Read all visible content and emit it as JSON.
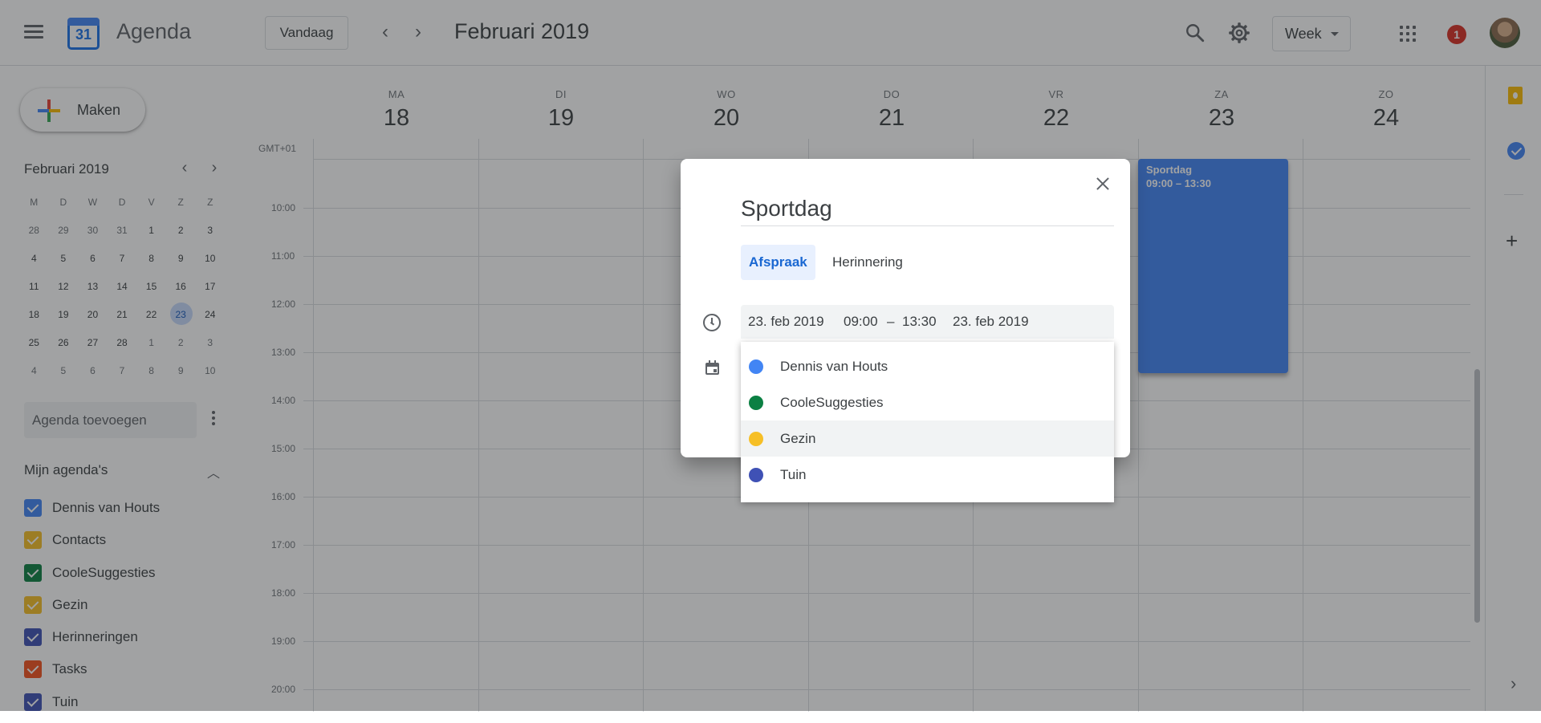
{
  "header": {
    "app_title": "Agenda",
    "logo_number": "31",
    "today_button": "Vandaag",
    "period_title": "Februari 2019",
    "view_selector": "Week",
    "notification_count": "1"
  },
  "sidebar": {
    "create_label": "Maken",
    "mini_calendar": {
      "title": "Februari 2019",
      "weekday_headers": [
        "M",
        "D",
        "W",
        "D",
        "V",
        "Z",
        "Z"
      ],
      "weeks": [
        [
          "28",
          "29",
          "30",
          "31",
          "1",
          "2",
          "3"
        ],
        [
          "4",
          "5",
          "6",
          "7",
          "8",
          "9",
          "10"
        ],
        [
          "11",
          "12",
          "13",
          "14",
          "15",
          "16",
          "17"
        ],
        [
          "18",
          "19",
          "20",
          "21",
          "22",
          "23",
          "24"
        ],
        [
          "25",
          "26",
          "27",
          "28",
          "1",
          "2",
          "3"
        ],
        [
          "4",
          "5",
          "6",
          "7",
          "8",
          "9",
          "10"
        ]
      ],
      "selected_day": "23"
    },
    "add_calendar_placeholder": "Agenda toevoegen",
    "my_calendars_title": "Mijn agenda's",
    "calendars": [
      {
        "name": "Dennis van Houts",
        "color": "#4285f4",
        "checked": true
      },
      {
        "name": "Contacts",
        "color": "#f6bf26",
        "checked": true
      },
      {
        "name": "CooleSuggesties",
        "color": "#0b8043",
        "checked": true
      },
      {
        "name": "Gezin",
        "color": "#f6bf26",
        "checked": true
      },
      {
        "name": "Herinneringen",
        "color": "#3f51b5",
        "checked": true
      },
      {
        "name": "Tasks",
        "color": "#f4511e",
        "checked": true
      },
      {
        "name": "Tuin",
        "color": "#3f51b5",
        "checked": true
      }
    ]
  },
  "week": {
    "timezone_label": "GMT+01",
    "days": [
      {
        "name": "MA",
        "number": "18"
      },
      {
        "name": "DI",
        "number": "19"
      },
      {
        "name": "WO",
        "number": "20"
      },
      {
        "name": "DO",
        "number": "21"
      },
      {
        "name": "VR",
        "number": "22"
      },
      {
        "name": "ZA",
        "number": "23"
      },
      {
        "name": "ZO",
        "number": "24"
      }
    ],
    "hours": [
      "10:00",
      "11:00",
      "12:00",
      "13:00",
      "14:00",
      "15:00",
      "16:00",
      "17:00",
      "18:00",
      "19:00",
      "20:00"
    ],
    "event": {
      "title": "Sportdag",
      "time": "09:00 – 13:30",
      "color": "#4285f4"
    }
  },
  "dialog": {
    "title_value": "Sportdag",
    "tabs": [
      "Afspraak",
      "Herinnering"
    ],
    "active_tab": "Afspraak",
    "start_date": "23. feb 2019",
    "start_time": "09:00",
    "separator": "–",
    "end_time": "13:30",
    "end_date": "23. feb 2019",
    "calendar_options": [
      {
        "name": "Dennis van Houts",
        "color": "#4285f4"
      },
      {
        "name": "CooleSuggesties",
        "color": "#0b8043"
      },
      {
        "name": "Gezin",
        "color": "#f6bf26"
      },
      {
        "name": "Tuin",
        "color": "#3f51b5"
      }
    ],
    "hovered_option": "Gezin"
  },
  "icons": {
    "menu": "menu-icon",
    "search": "search-icon",
    "settings": "gear-icon",
    "apps": "apps-grid-icon",
    "keep": "keep-icon",
    "tasks": "tasks-icon",
    "close": "close-icon",
    "clock": "clock-icon",
    "calendar": "calendar-icon"
  }
}
